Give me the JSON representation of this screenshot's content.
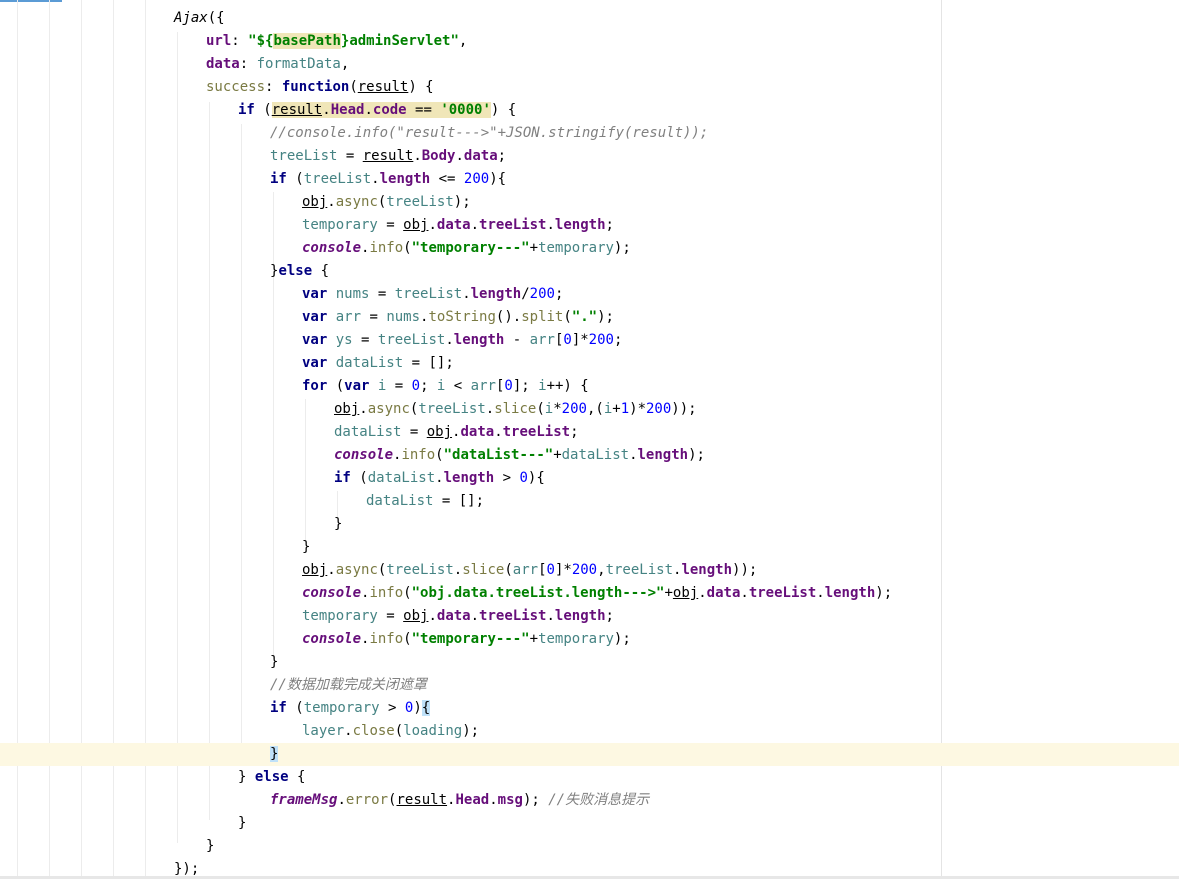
{
  "editor": {
    "colors": {
      "background": "#ffffff",
      "current_line": "#fdf8e2",
      "keyword": "#000080",
      "string": "#008000",
      "number": "#0000ff",
      "property": "#660e7a",
      "method": "#7a7a43",
      "local_variable": "#458383",
      "comment": "#808080",
      "match_highlight": "#f0e6b8",
      "brace_match": "#bfe1f9"
    },
    "lines": [
      {
        "indent": 0,
        "tokens": [
          {
            "t": "Ajax",
            "c": "it"
          },
          {
            "t": "({"
          }
        ]
      },
      {
        "indent": 1,
        "tokens": [
          {
            "t": "url",
            "c": "prop"
          },
          {
            "t": ": "
          },
          {
            "t": "\"${",
            "c": "str"
          },
          {
            "t": "basePath",
            "c": "str hl"
          },
          {
            "t": "}adminServlet\"",
            "c": "str"
          },
          {
            "t": ","
          }
        ]
      },
      {
        "indent": 1,
        "tokens": [
          {
            "t": "data",
            "c": "prop"
          },
          {
            "t": ": "
          },
          {
            "t": "formatData",
            "c": "loc"
          },
          {
            "t": ","
          }
        ]
      },
      {
        "indent": 1,
        "tokens": [
          {
            "t": "success",
            "c": "fn"
          },
          {
            "t": ": "
          },
          {
            "t": "function",
            "c": "kw"
          },
          {
            "t": "("
          },
          {
            "t": "result",
            "c": "u"
          },
          {
            "t": ") {"
          }
        ]
      },
      {
        "indent": 2,
        "tokens": [
          {
            "t": "if",
            "c": "kw"
          },
          {
            "t": " ("
          },
          {
            "t": "result",
            "c": "u hl"
          },
          {
            "t": ".",
            "c": "hl"
          },
          {
            "t": "Head",
            "c": "prop hl"
          },
          {
            "t": ".",
            "c": "hl"
          },
          {
            "t": "code",
            "c": "prop hl"
          },
          {
            "t": " == ",
            "c": "hl"
          },
          {
            "t": "'0000'",
            "c": "str hl"
          },
          {
            "t": ") {"
          }
        ]
      },
      {
        "indent": 3,
        "tokens": [
          {
            "t": "//console.info(\"result--->\"+JSON.stringify(result));",
            "c": "cmt"
          }
        ]
      },
      {
        "indent": 3,
        "tokens": [
          {
            "t": "treeList",
            "c": "loc"
          },
          {
            "t": " = "
          },
          {
            "t": "result",
            "c": "u"
          },
          {
            "t": "."
          },
          {
            "t": "Body",
            "c": "prop"
          },
          {
            "t": "."
          },
          {
            "t": "data",
            "c": "prop"
          },
          {
            "t": ";"
          }
        ]
      },
      {
        "indent": 3,
        "tokens": [
          {
            "t": "if",
            "c": "kw"
          },
          {
            "t": " ("
          },
          {
            "t": "treeList",
            "c": "loc"
          },
          {
            "t": "."
          },
          {
            "t": "length",
            "c": "prop"
          },
          {
            "t": " <= "
          },
          {
            "t": "200",
            "c": "num"
          },
          {
            "t": "){"
          }
        ]
      },
      {
        "indent": 4,
        "tokens": [
          {
            "t": "obj",
            "c": "u"
          },
          {
            "t": "."
          },
          {
            "t": "async",
            "c": "fn"
          },
          {
            "t": "("
          },
          {
            "t": "treeList",
            "c": "loc"
          },
          {
            "t": ");"
          }
        ]
      },
      {
        "indent": 4,
        "tokens": [
          {
            "t": "temporary",
            "c": "loc"
          },
          {
            "t": " = "
          },
          {
            "t": "obj",
            "c": "u"
          },
          {
            "t": "."
          },
          {
            "t": "data",
            "c": "prop"
          },
          {
            "t": "."
          },
          {
            "t": "treeList",
            "c": "prop"
          },
          {
            "t": "."
          },
          {
            "t": "length",
            "c": "prop"
          },
          {
            "t": ";"
          }
        ]
      },
      {
        "indent": 4,
        "tokens": [
          {
            "t": "console",
            "c": "gl"
          },
          {
            "t": "."
          },
          {
            "t": "info",
            "c": "fn"
          },
          {
            "t": "("
          },
          {
            "t": "\"temporary---\"",
            "c": "str"
          },
          {
            "t": "+"
          },
          {
            "t": "temporary",
            "c": "loc"
          },
          {
            "t": ");"
          }
        ]
      },
      {
        "indent": 3,
        "tokens": [
          {
            "t": "}"
          },
          {
            "t": "else",
            "c": "kw"
          },
          {
            "t": " {"
          }
        ]
      },
      {
        "indent": 4,
        "tokens": [
          {
            "t": "var",
            "c": "kw"
          },
          {
            "t": " "
          },
          {
            "t": "nums",
            "c": "loc"
          },
          {
            "t": " = "
          },
          {
            "t": "treeList",
            "c": "loc"
          },
          {
            "t": "."
          },
          {
            "t": "length",
            "c": "prop"
          },
          {
            "t": "/"
          },
          {
            "t": "200",
            "c": "num"
          },
          {
            "t": ";"
          }
        ]
      },
      {
        "indent": 4,
        "tokens": [
          {
            "t": "var",
            "c": "kw"
          },
          {
            "t": " "
          },
          {
            "t": "arr",
            "c": "loc"
          },
          {
            "t": " = "
          },
          {
            "t": "nums",
            "c": "loc"
          },
          {
            "t": "."
          },
          {
            "t": "toString",
            "c": "fn"
          },
          {
            "t": "()."
          },
          {
            "t": "split",
            "c": "fn"
          },
          {
            "t": "("
          },
          {
            "t": "\".\"",
            "c": "str"
          },
          {
            "t": ");"
          }
        ]
      },
      {
        "indent": 4,
        "tokens": [
          {
            "t": "var",
            "c": "kw"
          },
          {
            "t": " "
          },
          {
            "t": "ys",
            "c": "loc"
          },
          {
            "t": " = "
          },
          {
            "t": "treeList",
            "c": "loc"
          },
          {
            "t": "."
          },
          {
            "t": "length",
            "c": "prop"
          },
          {
            "t": " - "
          },
          {
            "t": "arr",
            "c": "loc"
          },
          {
            "t": "["
          },
          {
            "t": "0",
            "c": "num"
          },
          {
            "t": "]*"
          },
          {
            "t": "200",
            "c": "num"
          },
          {
            "t": ";"
          }
        ]
      },
      {
        "indent": 4,
        "tokens": [
          {
            "t": "var",
            "c": "kw"
          },
          {
            "t": " "
          },
          {
            "t": "dataList",
            "c": "loc"
          },
          {
            "t": " = [];"
          }
        ]
      },
      {
        "indent": 4,
        "tokens": [
          {
            "t": "for",
            "c": "kw"
          },
          {
            "t": " ("
          },
          {
            "t": "var",
            "c": "kw"
          },
          {
            "t": " "
          },
          {
            "t": "i",
            "c": "loc"
          },
          {
            "t": " = "
          },
          {
            "t": "0",
            "c": "num"
          },
          {
            "t": "; "
          },
          {
            "t": "i",
            "c": "loc"
          },
          {
            "t": " < "
          },
          {
            "t": "arr",
            "c": "loc"
          },
          {
            "t": "["
          },
          {
            "t": "0",
            "c": "num"
          },
          {
            "t": "]; "
          },
          {
            "t": "i",
            "c": "loc"
          },
          {
            "t": "++) {"
          }
        ]
      },
      {
        "indent": 5,
        "tokens": [
          {
            "t": "obj",
            "c": "u"
          },
          {
            "t": "."
          },
          {
            "t": "async",
            "c": "fn"
          },
          {
            "t": "("
          },
          {
            "t": "treeList",
            "c": "loc"
          },
          {
            "t": "."
          },
          {
            "t": "slice",
            "c": "fn"
          },
          {
            "t": "("
          },
          {
            "t": "i",
            "c": "loc"
          },
          {
            "t": "*"
          },
          {
            "t": "200",
            "c": "num"
          },
          {
            "t": ",("
          },
          {
            "t": "i",
            "c": "loc"
          },
          {
            "t": "+"
          },
          {
            "t": "1",
            "c": "num"
          },
          {
            "t": ")*"
          },
          {
            "t": "200",
            "c": "num"
          },
          {
            "t": "));"
          }
        ]
      },
      {
        "indent": 5,
        "tokens": [
          {
            "t": "dataList",
            "c": "loc"
          },
          {
            "t": " = "
          },
          {
            "t": "obj",
            "c": "u"
          },
          {
            "t": "."
          },
          {
            "t": "data",
            "c": "prop"
          },
          {
            "t": "."
          },
          {
            "t": "treeList",
            "c": "prop"
          },
          {
            "t": ";"
          }
        ]
      },
      {
        "indent": 5,
        "tokens": [
          {
            "t": "console",
            "c": "gl"
          },
          {
            "t": "."
          },
          {
            "t": "info",
            "c": "fn"
          },
          {
            "t": "("
          },
          {
            "t": "\"dataList---\"",
            "c": "str"
          },
          {
            "t": "+"
          },
          {
            "t": "dataList",
            "c": "loc"
          },
          {
            "t": "."
          },
          {
            "t": "length",
            "c": "prop"
          },
          {
            "t": ");"
          }
        ]
      },
      {
        "indent": 5,
        "tokens": [
          {
            "t": "if",
            "c": "kw"
          },
          {
            "t": " ("
          },
          {
            "t": "dataList",
            "c": "loc"
          },
          {
            "t": "."
          },
          {
            "t": "length",
            "c": "prop"
          },
          {
            "t": " > "
          },
          {
            "t": "0",
            "c": "num"
          },
          {
            "t": "){"
          }
        ]
      },
      {
        "indent": 6,
        "tokens": [
          {
            "t": "dataList",
            "c": "loc"
          },
          {
            "t": " = [];"
          }
        ]
      },
      {
        "indent": 5,
        "tokens": [
          {
            "t": "}"
          }
        ]
      },
      {
        "indent": 4,
        "tokens": [
          {
            "t": "}"
          }
        ]
      },
      {
        "indent": 4,
        "tokens": [
          {
            "t": "obj",
            "c": "u"
          },
          {
            "t": "."
          },
          {
            "t": "async",
            "c": "fn"
          },
          {
            "t": "("
          },
          {
            "t": "treeList",
            "c": "loc"
          },
          {
            "t": "."
          },
          {
            "t": "slice",
            "c": "fn"
          },
          {
            "t": "("
          },
          {
            "t": "arr",
            "c": "loc"
          },
          {
            "t": "["
          },
          {
            "t": "0",
            "c": "num"
          },
          {
            "t": "]*"
          },
          {
            "t": "200",
            "c": "num"
          },
          {
            "t": ","
          },
          {
            "t": "treeList",
            "c": "loc"
          },
          {
            "t": "."
          },
          {
            "t": "length",
            "c": "prop"
          },
          {
            "t": "));"
          }
        ]
      },
      {
        "indent": 4,
        "tokens": [
          {
            "t": "console",
            "c": "gl"
          },
          {
            "t": "."
          },
          {
            "t": "info",
            "c": "fn"
          },
          {
            "t": "("
          },
          {
            "t": "\"obj.data.treeList.length--->\"",
            "c": "str"
          },
          {
            "t": "+"
          },
          {
            "t": "obj",
            "c": "u"
          },
          {
            "t": "."
          },
          {
            "t": "data",
            "c": "prop"
          },
          {
            "t": "."
          },
          {
            "t": "treeList",
            "c": "prop"
          },
          {
            "t": "."
          },
          {
            "t": "length",
            "c": "prop"
          },
          {
            "t": ");"
          }
        ]
      },
      {
        "indent": 4,
        "tokens": [
          {
            "t": "temporary",
            "c": "loc"
          },
          {
            "t": " = "
          },
          {
            "t": "obj",
            "c": "u"
          },
          {
            "t": "."
          },
          {
            "t": "data",
            "c": "prop"
          },
          {
            "t": "."
          },
          {
            "t": "treeList",
            "c": "prop"
          },
          {
            "t": "."
          },
          {
            "t": "length",
            "c": "prop"
          },
          {
            "t": ";"
          }
        ]
      },
      {
        "indent": 4,
        "tokens": [
          {
            "t": "console",
            "c": "gl"
          },
          {
            "t": "."
          },
          {
            "t": "info",
            "c": "fn"
          },
          {
            "t": "("
          },
          {
            "t": "\"temporary---\"",
            "c": "str"
          },
          {
            "t": "+"
          },
          {
            "t": "temporary",
            "c": "loc"
          },
          {
            "t": ");"
          }
        ]
      },
      {
        "indent": 3,
        "tokens": [
          {
            "t": "}"
          }
        ]
      },
      {
        "indent": 3,
        "tokens": [
          {
            "t": "//数据加载完成关闭遮罩",
            "c": "cmt"
          }
        ]
      },
      {
        "indent": 3,
        "tokens": [
          {
            "t": "if",
            "c": "kw"
          },
          {
            "t": " ("
          },
          {
            "t": "temporary",
            "c": "loc"
          },
          {
            "t": " > "
          },
          {
            "t": "0",
            "c": "num"
          },
          {
            "t": ")"
          },
          {
            "t": "{",
            "c": "br"
          }
        ]
      },
      {
        "indent": 4,
        "tokens": [
          {
            "t": "layer",
            "c": "loc"
          },
          {
            "t": "."
          },
          {
            "t": "close",
            "c": "fn"
          },
          {
            "t": "("
          },
          {
            "t": "loading",
            "c": "loc"
          },
          {
            "t": ");"
          }
        ]
      },
      {
        "indent": 3,
        "current": true,
        "tokens": [
          {
            "t": "}",
            "c": "br"
          }
        ]
      },
      {
        "indent": 2,
        "tokens": [
          {
            "t": "} "
          },
          {
            "t": "else",
            "c": "kw"
          },
          {
            "t": " {"
          }
        ]
      },
      {
        "indent": 3,
        "tokens": [
          {
            "t": "frameMsg",
            "c": "gl"
          },
          {
            "t": "."
          },
          {
            "t": "error",
            "c": "fn"
          },
          {
            "t": "("
          },
          {
            "t": "result",
            "c": "u"
          },
          {
            "t": "."
          },
          {
            "t": "Head",
            "c": "prop"
          },
          {
            "t": "."
          },
          {
            "t": "msg",
            "c": "prop"
          },
          {
            "t": "); "
          },
          {
            "t": "//失败消息提示",
            "c": "cmt"
          }
        ]
      },
      {
        "indent": 2,
        "tokens": [
          {
            "t": "}"
          }
        ]
      },
      {
        "indent": 1,
        "tokens": [
          {
            "t": "}"
          }
        ]
      },
      {
        "indent": 0,
        "tokens": [
          {
            "t": "});"
          }
        ]
      }
    ]
  }
}
